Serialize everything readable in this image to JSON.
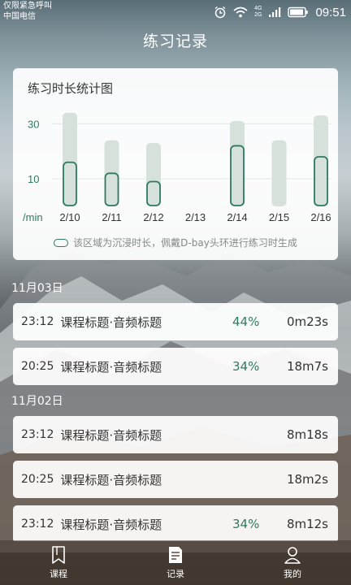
{
  "status_bar": {
    "carrier_line1": "仅限紧急呼叫",
    "carrier_line2": "中国电信",
    "network_labels": [
      "4G",
      "2G"
    ],
    "time": "09:51"
  },
  "header": {
    "title": "练习记录"
  },
  "chart_card": {
    "title": "练习时长统计图",
    "note": "该区域为沉浸时长，佩戴D-bay头环进行练习时生成",
    "colors": {
      "accent": "#2f7a62",
      "total_bar": "#d6e1dc",
      "immersive_fill": "#d6e1dc"
    }
  },
  "chart_data": {
    "type": "bar",
    "categories": [
      "2/10",
      "2/11",
      "2/12",
      "2/13",
      "2/14",
      "2/15",
      "2/16"
    ],
    "series": [
      {
        "values": [
          34,
          24,
          23,
          0,
          31,
          24,
          33
        ]
      },
      {
        "values": [
          16,
          12,
          9,
          0,
          22,
          0,
          18
        ]
      }
    ],
    "ylabel": "/min",
    "yticks": [
      10,
      30
    ],
    "ylim": [
      0,
      36
    ],
    "grid": true
  },
  "sections": [
    {
      "date": "11月03日",
      "records": [
        {
          "time": "23:12",
          "title": "课程标题·音频标题",
          "percent": "44%",
          "duration": "0m23s"
        },
        {
          "time": "20:25",
          "title": "课程标题·音频标题",
          "percent": "34%",
          "duration": "18m7s"
        }
      ]
    },
    {
      "date": "11月02日",
      "records": [
        {
          "time": "23:12",
          "title": "课程标题·音频标题",
          "percent": "",
          "duration": "8m18s"
        },
        {
          "time": "20:25",
          "title": "课程标题·音频标题",
          "percent": "",
          "duration": "18m2s"
        },
        {
          "time": "23:12",
          "title": "课程标题·音频标题",
          "percent": "34%",
          "duration": "8m12s"
        }
      ]
    }
  ],
  "tabs": [
    {
      "label": "课程",
      "icon": "bookmark-icon",
      "active": false
    },
    {
      "label": "记录",
      "icon": "document-icon",
      "active": true
    },
    {
      "label": "我的",
      "icon": "person-icon",
      "active": false
    }
  ]
}
